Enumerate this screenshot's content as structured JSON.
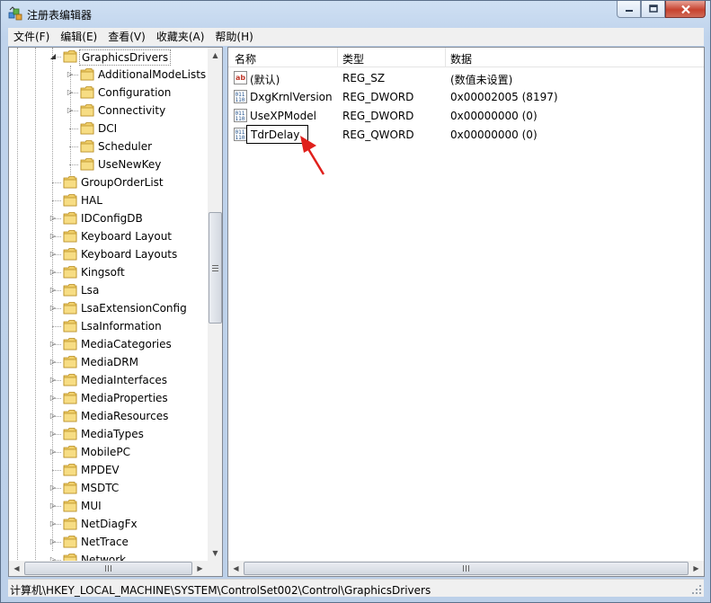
{
  "window": {
    "title": "注册表编辑器",
    "app_icon": "regedit-icon",
    "caption_buttons": [
      "minimize-icon",
      "maximize-icon",
      "close-icon"
    ]
  },
  "menu": [
    "文件(F)",
    "编辑(E)",
    "查看(V)",
    "收藏夹(A)",
    "帮助(H)"
  ],
  "tree": {
    "items": [
      {
        "label": "GraphicsDrivers",
        "expander": "expanded",
        "selected": true
      },
      {
        "label": "AdditionalModeLists",
        "expander": "collapsed"
      },
      {
        "label": "Configuration",
        "expander": "collapsed"
      },
      {
        "label": "Connectivity",
        "expander": "collapsed"
      },
      {
        "label": "DCI",
        "expander": "none"
      },
      {
        "label": "Scheduler",
        "expander": "none"
      },
      {
        "label": "UseNewKey",
        "expander": "none"
      },
      {
        "label": "GroupOrderList",
        "expander": "none"
      },
      {
        "label": "HAL",
        "expander": "none"
      },
      {
        "label": "IDConfigDB",
        "expander": "collapsed"
      },
      {
        "label": "Keyboard Layout",
        "expander": "collapsed"
      },
      {
        "label": "Keyboard Layouts",
        "expander": "collapsed"
      },
      {
        "label": "Kingsoft",
        "expander": "collapsed"
      },
      {
        "label": "Lsa",
        "expander": "collapsed"
      },
      {
        "label": "LsaExtensionConfig",
        "expander": "collapsed"
      },
      {
        "label": "LsaInformation",
        "expander": "none"
      },
      {
        "label": "MediaCategories",
        "expander": "collapsed"
      },
      {
        "label": "MediaDRM",
        "expander": "collapsed"
      },
      {
        "label": "MediaInterfaces",
        "expander": "collapsed"
      },
      {
        "label": "MediaProperties",
        "expander": "collapsed"
      },
      {
        "label": "MediaResources",
        "expander": "collapsed"
      },
      {
        "label": "MediaTypes",
        "expander": "collapsed"
      },
      {
        "label": "MobilePC",
        "expander": "collapsed"
      },
      {
        "label": "MPDEV",
        "expander": "none"
      },
      {
        "label": "MSDTC",
        "expander": "collapsed"
      },
      {
        "label": "MUI",
        "expander": "collapsed"
      },
      {
        "label": "NetDiagFx",
        "expander": "collapsed"
      },
      {
        "label": "NetTrace",
        "expander": "collapsed"
      },
      {
        "label": "Network",
        "expander": "collapsed"
      }
    ]
  },
  "columns": {
    "name": "名称",
    "type": "类型",
    "data": "数据"
  },
  "values": [
    {
      "name": "(默认)",
      "type": "REG_SZ",
      "data": "(数值未设置)",
      "icon": "string-value-icon"
    },
    {
      "name": "DxgKrnlVersion",
      "type": "REG_DWORD",
      "data": "0x00002005 (8197)",
      "icon": "binary-value-icon"
    },
    {
      "name": "UseXPModel",
      "type": "REG_DWORD",
      "data": "0x00000000 (0)",
      "icon": "binary-value-icon"
    },
    {
      "name": "TdrDelay",
      "type": "REG_QWORD",
      "data": "0x00000000 (0)",
      "icon": "binary-value-icon",
      "editing": true
    }
  ],
  "status": "计算机\\HKEY_LOCAL_MACHINE\\SYSTEM\\ControlSet002\\Control\\GraphicsDrivers",
  "colors": {
    "annotation_arrow": "#e0201c",
    "selection_border": "#888888"
  }
}
